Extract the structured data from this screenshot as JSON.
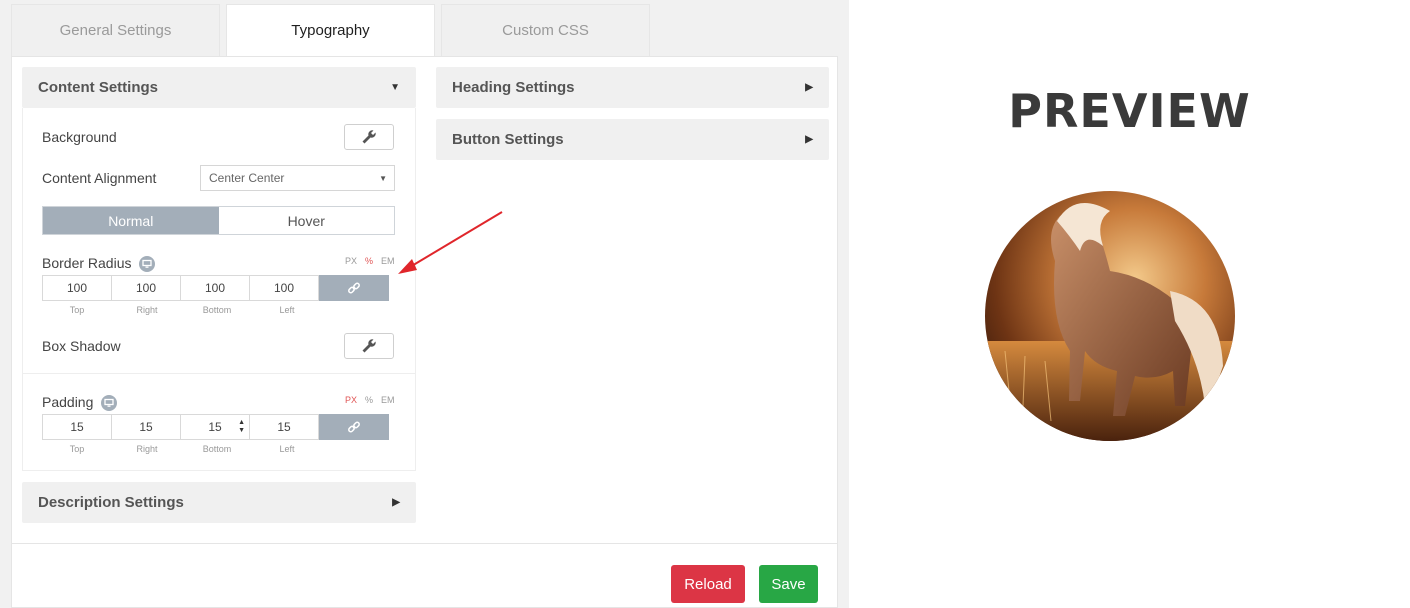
{
  "tabs": [
    {
      "label": "General Settings"
    },
    {
      "label": "Typography"
    },
    {
      "label": "Custom CSS"
    }
  ],
  "content_settings": {
    "title": "Content Settings",
    "background_label": "Background",
    "alignment_label": "Content Alignment",
    "alignment_value": "Center Center",
    "state_tabs": {
      "normal": "Normal",
      "hover": "Hover"
    },
    "border_radius": {
      "label": "Border Radius",
      "units": [
        "PX",
        "%",
        "EM"
      ],
      "selected_unit": "%",
      "values": {
        "top": "100",
        "right": "100",
        "bottom": "100",
        "left": "100"
      },
      "sublabels": {
        "top": "Top",
        "right": "Right",
        "bottom": "Bottom",
        "left": "Left"
      }
    },
    "box_shadow_label": "Box Shadow",
    "padding": {
      "label": "Padding",
      "units": [
        "PX",
        "%",
        "EM"
      ],
      "selected_unit": "PX",
      "values": {
        "top": "15",
        "right": "15",
        "bottom": "15",
        "left": "15"
      },
      "sublabels": {
        "top": "Top",
        "right": "Right",
        "bottom": "Bottom",
        "left": "Left"
      }
    }
  },
  "description_settings": {
    "title": "Description Settings"
  },
  "heading_settings": {
    "title": "Heading Settings"
  },
  "button_settings": {
    "title": "Button Settings"
  },
  "actions": {
    "reload": "Reload",
    "save": "Save"
  },
  "preview": {
    "title": "PREVIEW"
  },
  "colors": {
    "reload": "#dc3545",
    "save": "#28a745",
    "accent": "#a3aeb9",
    "annotation_arrow": "#e0262b"
  }
}
